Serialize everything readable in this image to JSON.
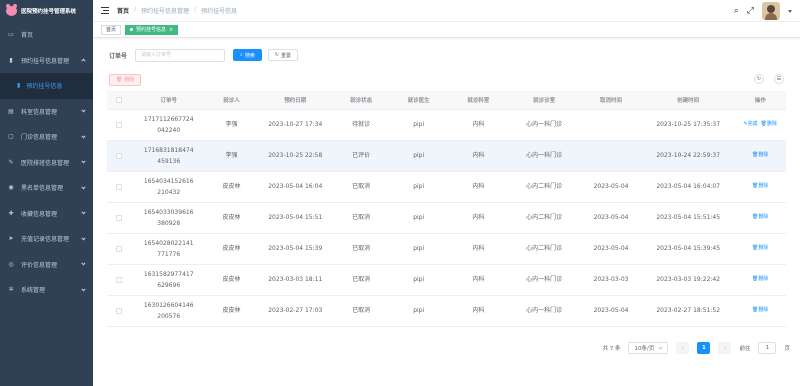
{
  "app": {
    "title": "医院预约挂号管理系统"
  },
  "sidebar": {
    "items": [
      {
        "label": "首页",
        "icon": "home-icon",
        "glyph": "▭",
        "has_children": false
      },
      {
        "label": "预约挂号信息管理",
        "icon": "chart-icon",
        "glyph": "▮",
        "has_children": true,
        "open": true,
        "children": [
          {
            "label": "预约挂号信息",
            "icon": "chart-icon",
            "glyph": "▮"
          }
        ]
      },
      {
        "label": "科室信息管理",
        "icon": "grid-icon",
        "glyph": "▤",
        "has_children": true
      },
      {
        "label": "门诊信息管理",
        "icon": "door-icon",
        "glyph": "▢",
        "has_children": true
      },
      {
        "label": "医院排班信息管理",
        "icon": "stethoscope-icon",
        "glyph": "✎",
        "has_children": true
      },
      {
        "label": "黑名单信息管理",
        "icon": "globe-icon",
        "glyph": "◉",
        "has_children": true
      },
      {
        "label": "收藏信息管理",
        "icon": "plus-icon",
        "glyph": "✚",
        "has_children": true
      },
      {
        "label": "充值记录信息管理",
        "icon": "send-icon",
        "glyph": "➤",
        "has_children": true
      },
      {
        "label": "评价信息管理",
        "icon": "eye-icon",
        "glyph": "◎",
        "has_children": true
      },
      {
        "label": "系统管理",
        "icon": "gear-icon",
        "glyph": "✲",
        "has_children": true
      }
    ]
  },
  "header": {
    "breadcrumb": [
      "首页",
      "预约挂号信息管理",
      "预约挂号信息"
    ],
    "search_icon": "search-icon",
    "fullscreen_icon": "fullscreen-icon"
  },
  "tags": [
    {
      "label": "首页",
      "active": false
    },
    {
      "label": "预约挂号信息",
      "active": true,
      "close": "×"
    }
  ],
  "search": {
    "label": "订单号",
    "placeholder": "请输入订单号",
    "search_btn": "搜索",
    "search_icon_glyph": "⌕",
    "reset_btn": "重置",
    "reset_icon_glyph": "↻"
  },
  "toolbar": {
    "delete_btn": "删除",
    "delete_icon_glyph": "🗑",
    "refresh_glyph": "↻",
    "columns_glyph": "☰"
  },
  "table": {
    "columns": [
      "",
      "订单号",
      "就诊人",
      "预约日期",
      "就诊状态",
      "就诊医生",
      "就诊科室",
      "就诊诊室",
      "取消时间",
      "创建时间",
      "操作"
    ],
    "rows": [
      {
        "order": "1717112667724042240",
        "patient": "李强",
        "date": "2023-10-27 17:34",
        "status": "待就诊",
        "doctor": "pipi",
        "dept": "内科",
        "room": "心内一科门诊",
        "cancel": "",
        "created": "2023-10-25 17:35:37",
        "actions": [
          "✎完成",
          "🗑删除"
        ]
      },
      {
        "order": "1716831818474459136",
        "patient": "李强",
        "date": "2023-10-25 22:58",
        "status": "已评价",
        "doctor": "pipi",
        "dept": "内科",
        "room": "心内一科门诊",
        "cancel": "",
        "created": "2023-10-24 22:59:37",
        "actions": [
          "🗑删除"
        ]
      },
      {
        "order": "1654034152616210432",
        "patient": "皮皮林",
        "date": "2023-05-04 16:04",
        "status": "已取消",
        "doctor": "pipi",
        "dept": "内科",
        "room": "心内二科门诊",
        "cancel": "2023-05-04",
        "created": "2023-05-04 16:04:07",
        "actions": [
          "🗑删除"
        ]
      },
      {
        "order": "1654033039616380928",
        "patient": "皮皮林",
        "date": "2023-05-04 15:51",
        "status": "已取消",
        "doctor": "pipi",
        "dept": "内科",
        "room": "心内二科门诊",
        "cancel": "2023-05-04",
        "created": "2023-05-04 15:51:45",
        "actions": [
          "🗑删除"
        ]
      },
      {
        "order": "1654028022141771776",
        "patient": "皮皮林",
        "date": "2023-05-04 15:39",
        "status": "已取消",
        "doctor": "pipi",
        "dept": "内科",
        "room": "心内二科门诊",
        "cancel": "2023-05-04",
        "created": "2023-05-04 15:39:45",
        "actions": [
          "🗑删除"
        ]
      },
      {
        "order": "1631582977417629696",
        "patient": "皮皮林",
        "date": "2023-03-03 18:11",
        "status": "已取消",
        "doctor": "pipi",
        "dept": "内科",
        "room": "心内一科门诊",
        "cancel": "2023-03-03",
        "created": "2023-03-03 19:22:42",
        "actions": [
          "🗑删除"
        ]
      },
      {
        "order": "1630126604146200576",
        "patient": "皮皮林",
        "date": "2023-02-27 17:03",
        "status": "已取消",
        "doctor": "pipi",
        "dept": "内科",
        "room": "心内一科门诊",
        "cancel": "2023-05-04",
        "created": "2023-02-27 18:51:52",
        "actions": [
          "🗑删除"
        ]
      }
    ]
  },
  "pagination": {
    "total": "共 7 条",
    "page_size": "10条/页",
    "prev": "‹",
    "current": "1",
    "next": "›",
    "goto_label": "前往",
    "goto_value": "1",
    "goto_suffix": "页"
  }
}
